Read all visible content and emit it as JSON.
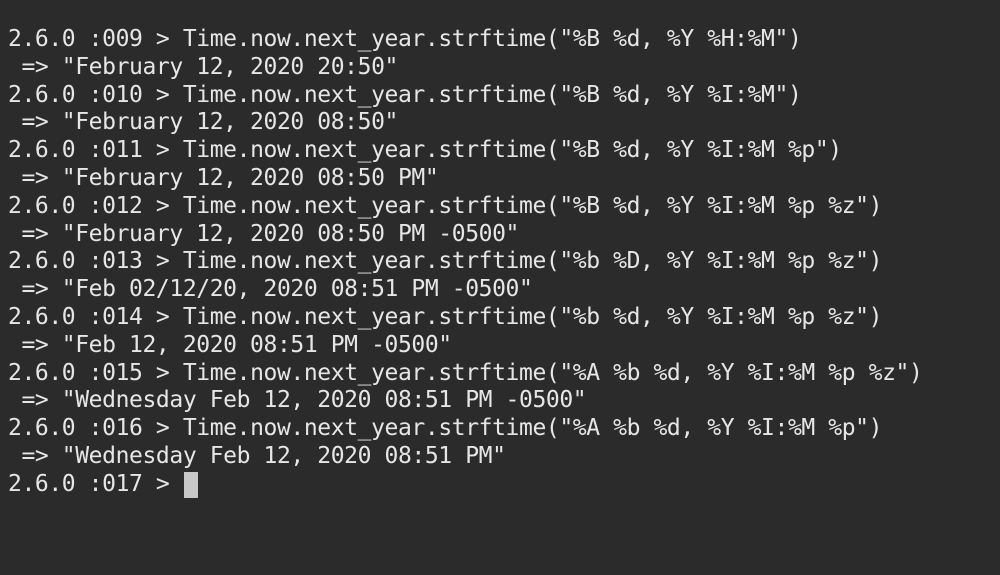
{
  "terminal": {
    "lines": [
      {
        "prompt": "2.6.0 :009 > ",
        "input": "Time.now.next_year.strftime(\"%B %d, %Y %H:%M\")",
        "output": " => \"February 12, 2020 20:50\""
      },
      {
        "prompt": "2.6.0 :010 > ",
        "input": "Time.now.next_year.strftime(\"%B %d, %Y %I:%M\")",
        "output": " => \"February 12, 2020 08:50\""
      },
      {
        "prompt": "2.6.0 :011 > ",
        "input": "Time.now.next_year.strftime(\"%B %d, %Y %I:%M %p\")",
        "output": " => \"February 12, 2020 08:50 PM\""
      },
      {
        "prompt": "2.6.0 :012 > ",
        "input": "Time.now.next_year.strftime(\"%B %d, %Y %I:%M %p %z\")",
        "output": " => \"February 12, 2020 08:50 PM -0500\""
      },
      {
        "prompt": "2.6.0 :013 > ",
        "input": "Time.now.next_year.strftime(\"%b %D, %Y %I:%M %p %z\")",
        "output": " => \"Feb 02/12/20, 2020 08:51 PM -0500\""
      },
      {
        "prompt": "2.6.0 :014 > ",
        "input": "Time.now.next_year.strftime(\"%b %d, %Y %I:%M %p %z\")",
        "output": " => \"Feb 12, 2020 08:51 PM -0500\""
      },
      {
        "prompt": "2.6.0 :015 > ",
        "input": "Time.now.next_year.strftime(\"%A %b %d, %Y %I:%M %p %z\")",
        "output": " => \"Wednesday Feb 12, 2020 08:51 PM -0500\""
      },
      {
        "prompt": "2.6.0 :016 > ",
        "input": "Time.now.next_year.strftime(\"%A %b %d, %Y %I:%M %p\")",
        "output": " => \"Wednesday Feb 12, 2020 08:51 PM\""
      }
    ],
    "current_prompt": "2.6.0 :017 > "
  }
}
